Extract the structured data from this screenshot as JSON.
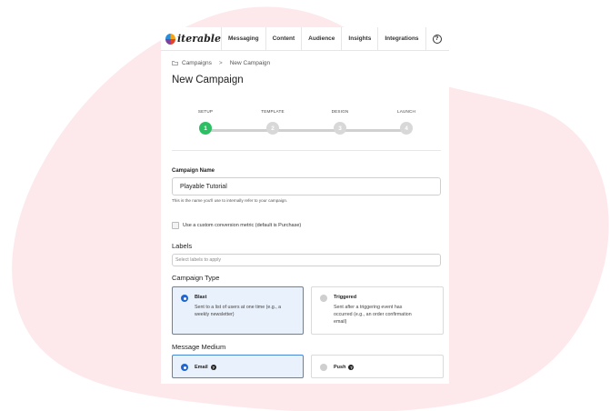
{
  "colors": {
    "background_blob": "#fde8ec",
    "accent_green": "#2dbf63",
    "accent_blue": "#1f66d1",
    "selected_bg": "#e9f1fc"
  },
  "nav": {
    "logo": "iterable",
    "items": [
      "Messaging",
      "Content",
      "Audience",
      "Insights",
      "Integrations"
    ],
    "help": "?"
  },
  "breadcrumb": {
    "icon": "folder-icon",
    "parent": "Campaigns",
    "separator": ">",
    "current": "New Campaign"
  },
  "page_title": "New Campaign",
  "stepper": {
    "steps": [
      {
        "label": "SETUP",
        "number": "1",
        "active": true
      },
      {
        "label": "TEMPLATE",
        "number": "2",
        "active": false
      },
      {
        "label": "DESIGN",
        "number": "3",
        "active": false
      },
      {
        "label": "LAUNCH",
        "number": "4",
        "active": false
      }
    ]
  },
  "campaign_name": {
    "label": "Campaign Name",
    "value": "Playable Tutorial",
    "help": "This is the name you'll use to internally refer to your campaign."
  },
  "conversion_checkbox": {
    "label": "Use a custom conversion metric (default is Purchase)",
    "checked": false
  },
  "labels": {
    "heading": "Labels",
    "placeholder": "Select labels to apply"
  },
  "campaign_type": {
    "heading": "Campaign Type",
    "options": [
      {
        "title": "Blast",
        "desc_lines": [
          "Sent to a list of users at one time (e.g., a",
          "weekly newsletter)"
        ],
        "selected": true
      },
      {
        "title": "Triggered",
        "desc_lines": [
          "Sent after a triggering event has",
          "occurred (e.g., an order confirmation",
          "email)"
        ],
        "selected": false
      }
    ]
  },
  "message_medium": {
    "heading": "Message Medium",
    "options": [
      {
        "title": "Email",
        "selected": true
      },
      {
        "title": "Push",
        "selected": false
      }
    ]
  }
}
